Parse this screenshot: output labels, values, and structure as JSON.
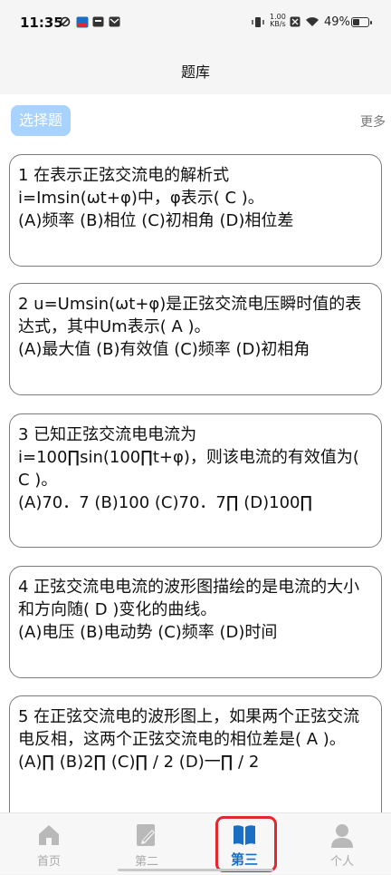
{
  "status_bar": {
    "time": "11:35",
    "speed_value": "1.00",
    "speed_unit": "KB/s",
    "battery": "49%",
    "battery_level": 0.49
  },
  "header": {
    "title": "题库"
  },
  "category": {
    "chip": "选择题",
    "more": "更多"
  },
  "questions": [
    {
      "text": "1 在表示正弦交流电的解析式\ni=Imsin(ωt+φ)中，φ表示( C )。\n(A)频率 (B)相位 (C)初相角 (D)相位差"
    },
    {
      "text": "2 u=Umsin(ωt+φ)是正弦交流电压瞬时值的表达式，其中Um表示( A )。\n(A)最大值 (B)有效值 (C)频率 (D)初相角"
    },
    {
      "text": "3 已知正弦交流电电流为\ni=100∏sin(100∏t+φ)，则该电流的有效值为( C )。\n(A)70．7 (B)100 (C)70．7∏ (D)100∏"
    },
    {
      "text": "4 正弦交流电电流的波形图描绘的是电流的大小和方向随( D )变化的曲线。\n(A)电压 (B)电动势 (C)频率 (D)时间"
    },
    {
      "text": "5 在正弦交流电的波形图上，如果两个正弦交流电反相，这两个正弦交流电的相位差是( A )。\n(A)∏ (B)2∏ (C)∏ / 2 (D)一∏ / 2"
    }
  ],
  "tabs": [
    {
      "label": "首页",
      "icon": "home-icon"
    },
    {
      "label": "第二",
      "icon": "edit-document-icon"
    },
    {
      "label": "第三",
      "icon": "book-icon"
    },
    {
      "label": "个人",
      "icon": "person-icon"
    }
  ],
  "active_tab": "第三",
  "colors": {
    "accent": "#1a6fc4",
    "chip_bg": "#a8d2ff",
    "highlight": "#e0282e"
  }
}
